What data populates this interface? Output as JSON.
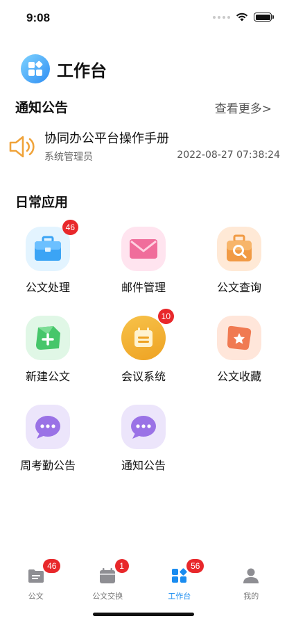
{
  "status": {
    "time": "9:08"
  },
  "header": {
    "title": "工作台"
  },
  "notice_section": {
    "title": "通知公告",
    "more": "查看更多>"
  },
  "notice": {
    "title": "协同办公平台操作手册",
    "author": "系统管理员",
    "time": "2022-08-27 07:38:24"
  },
  "apps_section": {
    "title": "日常应用"
  },
  "apps": [
    {
      "label": "公文处理",
      "icon": "briefcase-icon",
      "badge": "46"
    },
    {
      "label": "邮件管理",
      "icon": "mail-icon",
      "badge": ""
    },
    {
      "label": "公文查询",
      "icon": "search-bag-icon",
      "badge": ""
    },
    {
      "label": "新建公文",
      "icon": "add-doc-icon",
      "badge": ""
    },
    {
      "label": "会议系统",
      "icon": "calendar-icon",
      "badge": "10"
    },
    {
      "label": "公文收藏",
      "icon": "star-icon",
      "badge": ""
    },
    {
      "label": "周考勤公告",
      "icon": "chat-bubble-icon",
      "badge": ""
    },
    {
      "label": "通知公告",
      "icon": "chat-bubble-icon",
      "badge": ""
    }
  ],
  "tabs": [
    {
      "label": "公文",
      "icon": "document-icon",
      "badge": "46",
      "active": false
    },
    {
      "label": "公文交换",
      "icon": "calendar-icon",
      "badge": "1",
      "active": false
    },
    {
      "label": "工作台",
      "icon": "grid-icon",
      "badge": "56",
      "active": true
    },
    {
      "label": "我的",
      "icon": "person-icon",
      "badge": "",
      "active": false
    }
  ],
  "colors": {
    "accent": "#1a8cf0",
    "badge": "#e8282b",
    "speaker": "#f0a33a"
  }
}
